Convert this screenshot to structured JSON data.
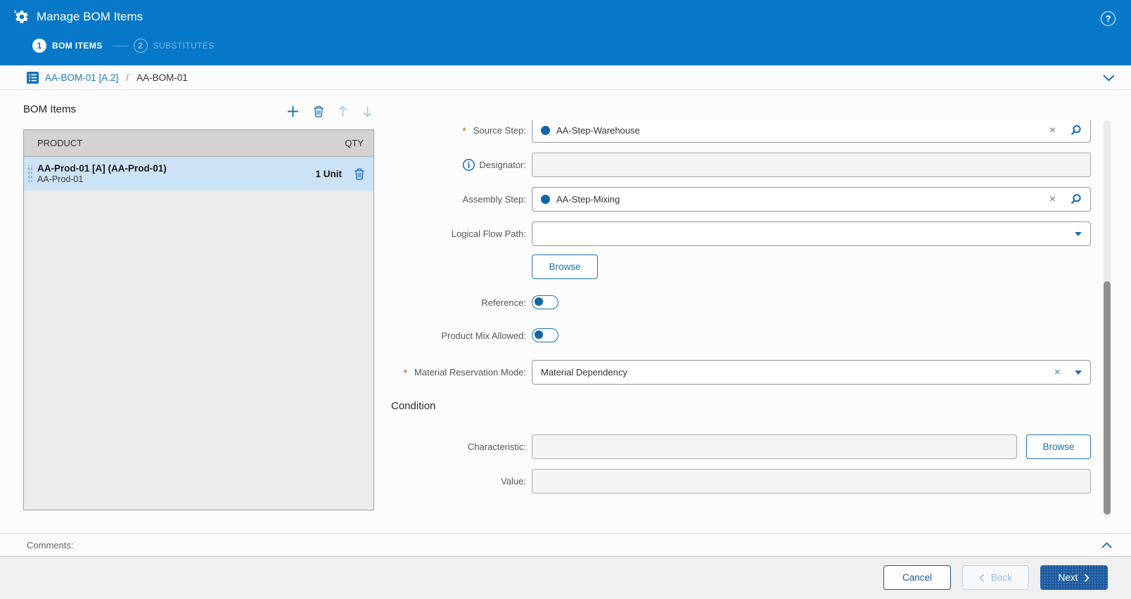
{
  "header": {
    "title": "Manage BOM Items",
    "steps": [
      {
        "number": "1",
        "label": "BOM ITEMS",
        "active": true
      },
      {
        "number": "2",
        "label": "SUBSTITUTES",
        "active": false
      }
    ]
  },
  "breadcrumb": {
    "link": "AA-BOM-01 [A.2]",
    "separator": "/",
    "current": "AA-BOM-01"
  },
  "bom_panel": {
    "title": "BOM Items",
    "columns": {
      "product": "PRODUCT",
      "qty": "QTY"
    },
    "rows": [
      {
        "title": "AA-Prod-01 [A] (AA-Prod-01)",
        "subtitle": "AA-Prod-01",
        "qty": "1 Unit",
        "selected": true
      }
    ]
  },
  "form": {
    "source_step": {
      "required": "*",
      "label": "Source Step:",
      "value": "AA-Step-Warehouse"
    },
    "designator": {
      "label": "Designator:",
      "value": ""
    },
    "assembly_step": {
      "label": "Assembly Step:",
      "value": "AA-Step-Mixing"
    },
    "logical_flow_path": {
      "label": "Logical Flow Path:",
      "value": ""
    },
    "browse_label": "Browse",
    "reference": {
      "label": "Reference:",
      "state": "off"
    },
    "product_mix": {
      "label": "Product Mix Allowed:",
      "state": "off"
    },
    "material_reservation_mode": {
      "required": "*",
      "label": "Material Reservation Mode:",
      "value": "Material Dependency"
    },
    "condition": {
      "title": "Condition",
      "characteristic": {
        "label": "Characteristic:",
        "value": ""
      },
      "browse_label": "Browse",
      "value": {
        "label": "Value:",
        "value": ""
      }
    }
  },
  "comments": {
    "label": "Comments:"
  },
  "footer": {
    "cancel": "Cancel",
    "back": "Back",
    "next": "Next"
  },
  "colors": {
    "header_blue": "#0778c8",
    "primary_dark_blue": "#1b5a9e",
    "selection_blue": "#cce2f5",
    "required_asterisk": "#b25417",
    "icon_blue": "#1a6fb5"
  }
}
